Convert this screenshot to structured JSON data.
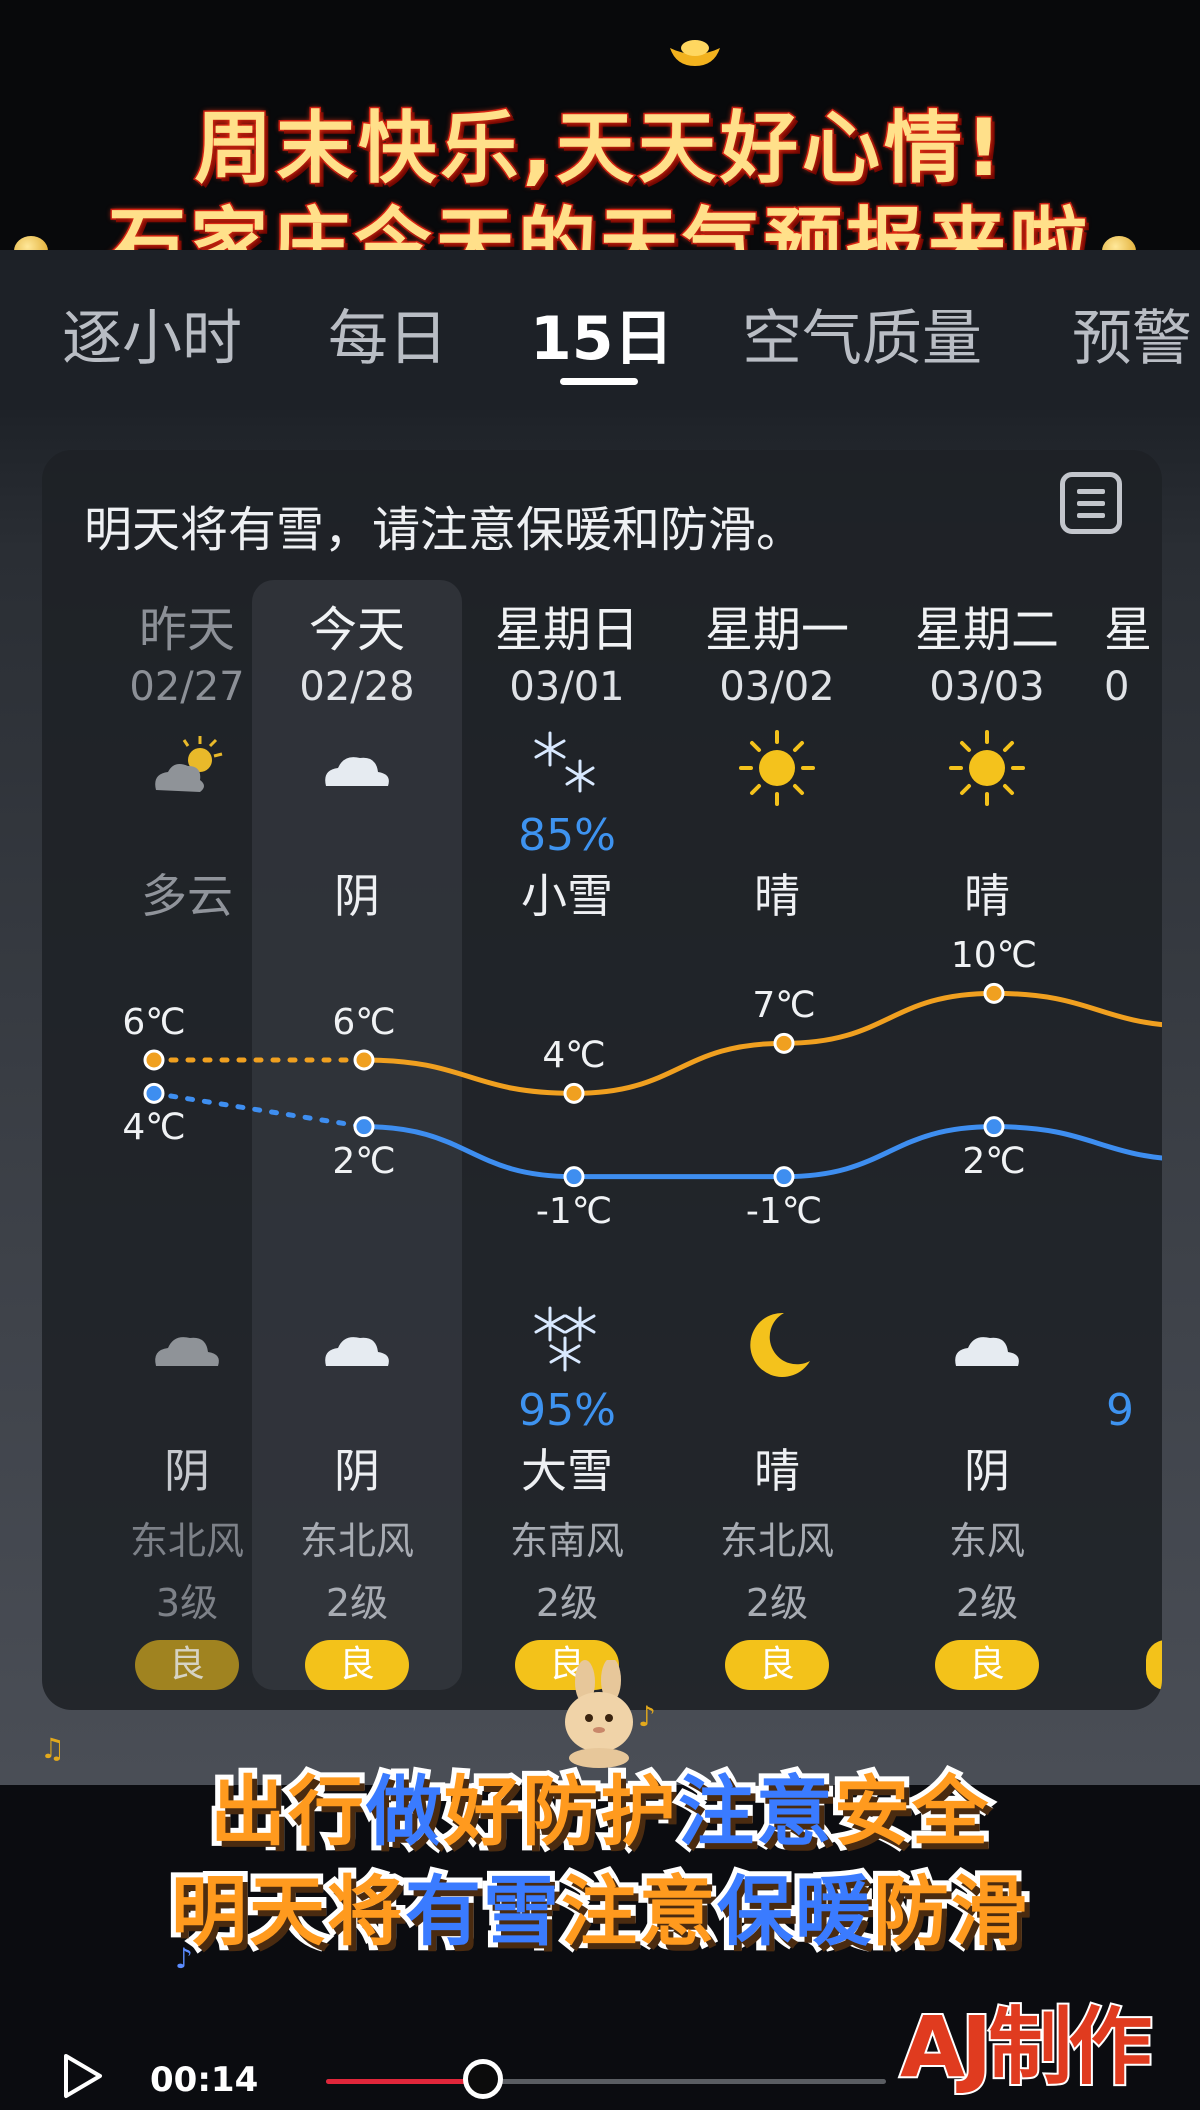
{
  "overlay": {
    "headline_line1": "周末快乐,天天好心情!",
    "headline_line2": "石家庄今天的天气预报来啦",
    "caption_line1_parts": [
      "出行",
      "做",
      "好",
      "防护",
      "注意",
      "安全"
    ],
    "caption_line2_parts": [
      "明天将",
      "有雪",
      "注意",
      "保暖",
      "防滑"
    ],
    "logo_text": "AJ制作"
  },
  "tabs": [
    {
      "label": "逐小时",
      "active": false
    },
    {
      "label": "每日",
      "active": false
    },
    {
      "label": "15日",
      "active": true
    },
    {
      "label": "空气质量",
      "active": false
    },
    {
      "label": "预警",
      "active": false
    }
  ],
  "card": {
    "alert_text": "明天将有雪，请注意保暖和防滑。",
    "menu_icon": "list-icon"
  },
  "days": [
    {
      "name": "昨天",
      "date": "02/27",
      "day_icon": "partly-cloudy-icon",
      "day_prob": "",
      "day_cond": "多云",
      "high": "6℃",
      "low": "4℃",
      "night_icon": "cloud-icon",
      "night_prob": "",
      "night_cond": "阴",
      "wind": "东北风",
      "level": "3级",
      "aqi": "良"
    },
    {
      "name": "今天",
      "date": "02/28",
      "day_icon": "cloud-icon",
      "day_prob": "",
      "day_cond": "阴",
      "high": "6℃",
      "low": "2℃",
      "night_icon": "cloud-icon",
      "night_prob": "",
      "night_cond": "阴",
      "wind": "东北风",
      "level": "2级",
      "aqi": "良"
    },
    {
      "name": "星期日",
      "date": "03/01",
      "day_icon": "snowflake-icon",
      "day_prob": "85%",
      "day_cond": "小雪",
      "high": "4℃",
      "low": "-1℃",
      "night_icon": "snowflake-icon",
      "night_prob": "95%",
      "night_cond": "大雪",
      "wind": "东南风",
      "level": "2级",
      "aqi": "良"
    },
    {
      "name": "星期一",
      "date": "03/02",
      "day_icon": "sun-icon",
      "day_prob": "",
      "day_cond": "晴",
      "high": "7℃",
      "low": "-1℃",
      "night_icon": "moon-icon",
      "night_prob": "",
      "night_cond": "晴",
      "wind": "东北风",
      "level": "2级",
      "aqi": "良"
    },
    {
      "name": "星期二",
      "date": "03/03",
      "day_icon": "sun-icon",
      "day_prob": "",
      "day_cond": "晴",
      "high": "10℃",
      "low": "2℃",
      "night_icon": "cloud-icon",
      "night_prob": "",
      "night_cond": "阴",
      "wind": "东风",
      "level": "2级",
      "aqi": "良"
    },
    {
      "name": "星",
      "date": "0",
      "night_prob": "9"
    }
  ],
  "chart_data": {
    "type": "line",
    "categories": [
      "02/27",
      "02/28",
      "03/01",
      "03/02",
      "03/03",
      ""
    ],
    "series": [
      {
        "values": [
          6,
          6,
          4,
          7,
          10,
          8
        ],
        "color": "#f0a020"
      },
      {
        "values": [
          4,
          2,
          -1,
          -1,
          2,
          0
        ],
        "color": "#3e8ef0"
      }
    ],
    "ylim": [
      -3,
      12
    ]
  },
  "player": {
    "time": "00:14",
    "progress": 0.28,
    "play_icon": "play-icon"
  },
  "colors": {
    "accent_yellow": "#f3c21a",
    "prob_blue": "#3e93f0",
    "high_line": "#f0a020",
    "low_line": "#3e8ef0"
  }
}
